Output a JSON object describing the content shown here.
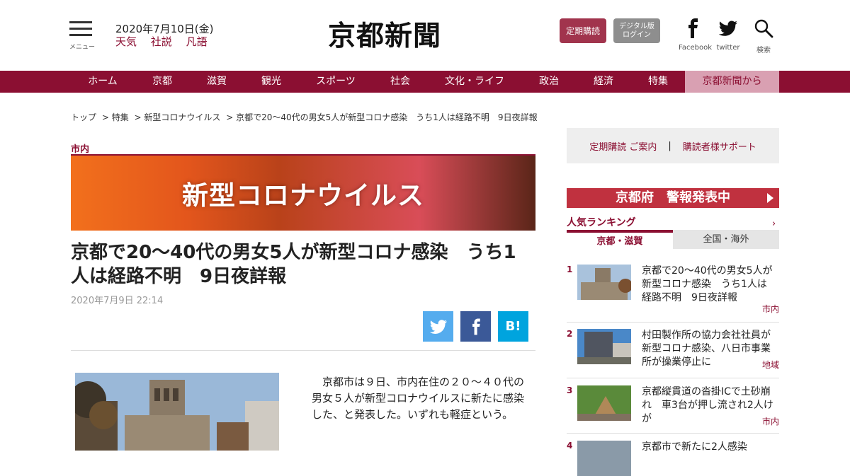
{
  "header": {
    "menu_label": "メニュー",
    "date": "2020年7月10日(金)",
    "links": [
      "天気",
      "社説",
      "凡語"
    ],
    "logo": "京都新聞",
    "subscribe_button": "定期購読",
    "digital_button_line1": "デジタル版",
    "digital_button_line2": "ログイン",
    "facebook_label": "Facebook",
    "twitter_label": "twitter",
    "search_label": "検索"
  },
  "nav": {
    "items": [
      "ホーム",
      "京都",
      "滋賀",
      "観光",
      "スポーツ",
      "社会",
      "文化・ライフ",
      "政治",
      "経済",
      "特集",
      "京都新聞から"
    ],
    "active_index": 10
  },
  "breadcrumb": [
    "トップ",
    "> 特集",
    "> 新型コロナウイルス",
    "> 京都で20～40代の男女5人が新型コロナ感染　うち1人は経路不明　9日夜詳報"
  ],
  "article": {
    "category": "市内",
    "banner_text": "新型コロナウイルス",
    "title": "京都で20～40代の男女5人が新型コロナ感染　うち1人は経路不明　9日夜詳報",
    "date": "2020年7月9日 22:14",
    "share": {
      "twitter_color": "#55acee",
      "facebook_color": "#3b5998",
      "hatena_color": "#00a4de",
      "hatena_label": "B!"
    },
    "body": "京都市は９日、市内在住の２０～４０代の男女５人が新型コロナウイルスに新たに感染した、と発表した。いずれも軽症という。"
  },
  "sidebar": {
    "support_link1": "定期購読 ご案内",
    "support_sep": "|",
    "support_link2": "購読者様サポート",
    "warning_banner": "京都府　警報発表中",
    "ranking_title": "人気ランキング",
    "ranking_more": "›",
    "tabs": [
      "京都・滋賀",
      "全国・海外"
    ],
    "ranking": [
      {
        "num": "1",
        "title": "京都で20～40代の男女5人が新型コロナ感染　うち1人は経路不明　9日夜詳報",
        "tag": "市内"
      },
      {
        "num": "2",
        "title": "村田製作所の協力会社社員が新型コロナ感染、八日市事業所が操業停止に",
        "tag": "地域"
      },
      {
        "num": "3",
        "title": "京都縦貫道の沓掛ICで土砂崩れ　車3台が押し流され2人けが",
        "tag": "市内"
      },
      {
        "num": "4",
        "title": "京都市で新たに2人感染",
        "tag": ""
      }
    ]
  },
  "colors": {
    "brand": "#8b0f32",
    "nav_active_bg": "#d9a0b2",
    "warning": "#c0313f"
  }
}
